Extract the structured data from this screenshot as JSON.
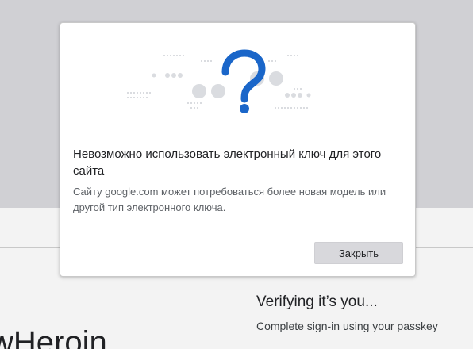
{
  "dialog": {
    "title": "Невозможно использовать электронный ключ для этого сайта",
    "body": "Сайту google.com может потребоваться более новая модель или другой тип электронного ключа.",
    "close_label": "Закрыть",
    "illustration_glyph": "?"
  },
  "background": {
    "heading_partial": "wHeroin",
    "verifying_title": "Verifying it’s you...",
    "verifying_subtitle": "Complete sign-in using your passkey"
  },
  "colors": {
    "accent": "#1a66c9",
    "dot": "#dadce0",
    "overlay": "#d0d0d4",
    "button_bg": "#d8d8dc"
  },
  "icons": [
    "question-mark-icon"
  ]
}
